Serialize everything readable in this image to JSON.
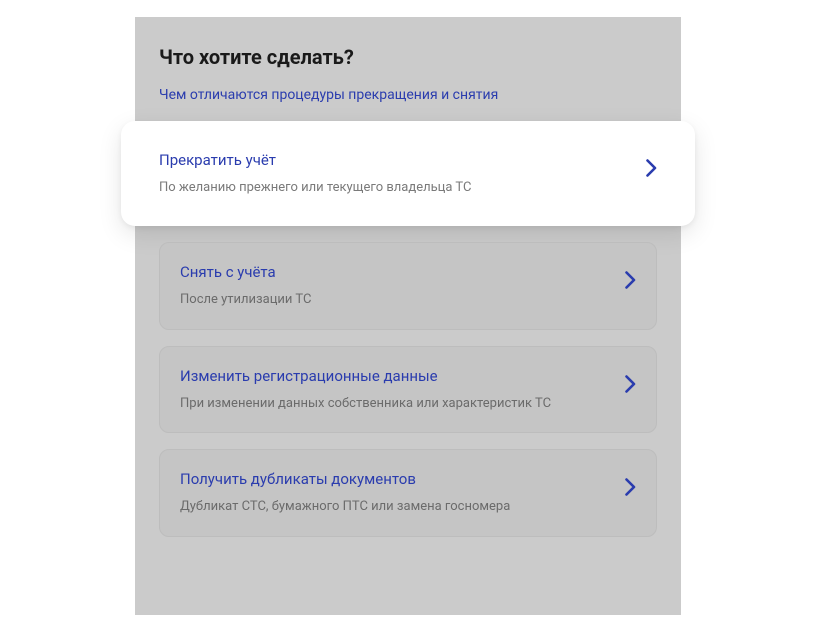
{
  "heading": "Что хотите сделать?",
  "info_link": "Чем отличаются процедуры прекращения и снятия",
  "options": [
    {
      "title": "Прекратить учёт",
      "desc": "По желанию прежнего или текущего владельца ТС"
    },
    {
      "title": "Снять с учёта",
      "desc": "После утилизации ТС"
    },
    {
      "title": "Изменить регистрационные данные",
      "desc": "При изменении данных собственника или характеристик ТС"
    },
    {
      "title": "Получить дубликаты документов",
      "desc": "Дубликат СТС, бумажного ПТС или замена госномера"
    }
  ],
  "colors": {
    "accent": "#2a3cae",
    "panel_bg": "#cbcbcb",
    "card_bg": "#c5c5c5"
  }
}
